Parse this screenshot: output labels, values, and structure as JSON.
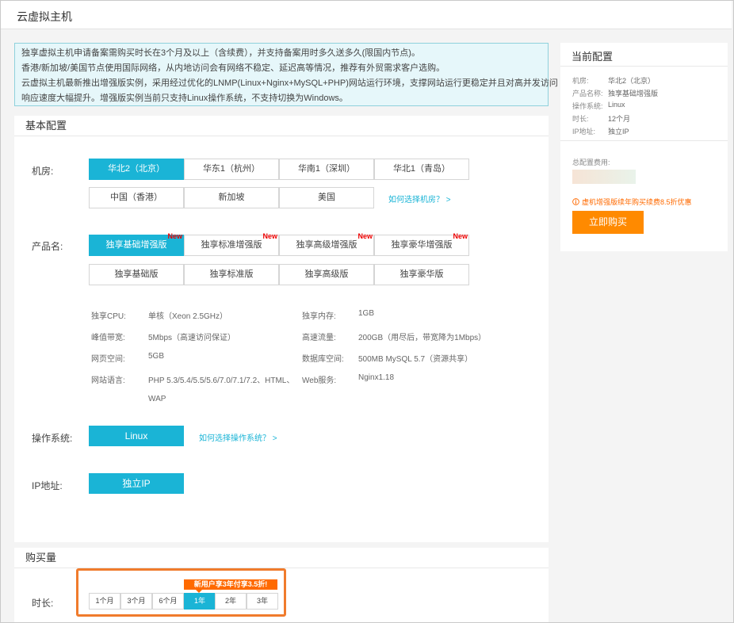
{
  "window_title": "云虚拟主机",
  "notice": [
    "独享虚拟主机申请备案需购买时长在3个月及以上（含续费），并支持备案用时多久送多久(限国内节点)。",
    "香港/新加坡/美国节点使用国际网络，从内地访问会有网络不稳定、延迟高等情况，推荐有外贸需求客户选购。",
    "云虚拟主机最新推出增强版实例，采用经过优化的LNMP(Linux+Nginx+MySQL+PHP)网站运行环境，支撑网站运行更稳定并且对高并发访问",
    "响应速度大幅提升。增强版实例当前只支持Linux操作系统，不支持切换为Windows。"
  ],
  "basic": {
    "title": "基本配置",
    "region_label": "机房:",
    "regions": [
      "华北2（北京）",
      "华东1（杭州）",
      "华南1（深圳）",
      "华北1（青岛）",
      "中国（香港）",
      "新加坡",
      "美国"
    ],
    "region_link": "如何选择机房？ >",
    "product_label": "产品名:",
    "products": [
      "独享基础增强版",
      "独享标准增强版",
      "独享高级增强版",
      "独享豪华增强版",
      "独享基础版",
      "独享标准版",
      "独享高级版",
      "独享豪华版"
    ],
    "new_tag": "New",
    "specs": [
      {
        "k": "独享CPU:",
        "v": "单核（Xeon 2.5GHz）"
      },
      {
        "k": "独享内存:",
        "v": "1GB"
      },
      {
        "k": "峰值带宽:",
        "v": "5Mbps（高速访问保证）"
      },
      {
        "k": "高速流量:",
        "v": "200GB（用尽后，带宽降为1Mbps）"
      },
      {
        "k": "网页空间:",
        "v": "5GB"
      },
      {
        "k": "数据库空间:",
        "v": "500MB MySQL 5.7（资源共享）"
      },
      {
        "k": "网站语言:",
        "v": "PHP 5.3/5.4/5.5/5.6/7.0/7.1/7.2、HTML、"
      },
      {
        "k": "Web服务:",
        "v": "Nginx1.18"
      }
    ],
    "spec_wrap": "WAP",
    "os_label": "操作系统:",
    "os_value": "Linux",
    "os_link": "如何选择操作系统？ >",
    "ip_label": "IP地址:",
    "ip_value": "独立IP"
  },
  "purchase": {
    "title": "购买量",
    "duration_label": "时长:",
    "durations": [
      "1个月",
      "3个月",
      "6个月",
      "1年",
      "2年",
      "3年"
    ],
    "selected_index": 3,
    "tip": "新用户享3年付享3.5折!"
  },
  "summary": {
    "title": "当前配置",
    "items": [
      {
        "k": "机房:",
        "v": "华北2（北京）"
      },
      {
        "k": "产品名称:",
        "v": "独享基础增强版"
      },
      {
        "k": "操作系统:",
        "v": "Linux"
      },
      {
        "k": "时长:",
        "v": "12个月"
      },
      {
        "k": "IP地址:",
        "v": "独立IP"
      }
    ],
    "total_label": "总配置费用:",
    "promo": "虚机增强版续年购买续费8.5折优惠",
    "buy_button": "立即购买"
  },
  "colors": {
    "accent": "#1ab4d6",
    "orange": "#ff8a00",
    "highlight": "#f07b2c"
  }
}
